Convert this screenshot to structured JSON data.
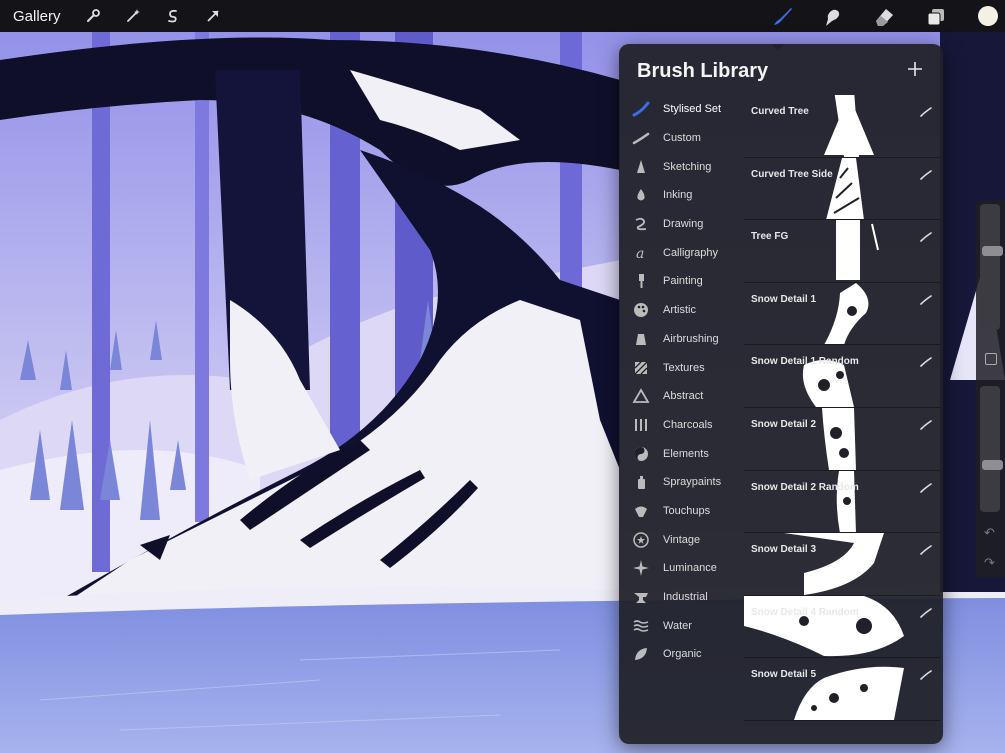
{
  "toolbar": {
    "gallery_label": "Gallery",
    "left_icons": [
      "wrench-icon",
      "magic-wand-icon",
      "selection-icon",
      "transform-arrow-icon"
    ],
    "right_icons": [
      "brush-icon",
      "smudge-icon",
      "eraser-icon",
      "layers-icon"
    ],
    "active_tool": "brush",
    "active_color": "#f4f1e4",
    "accent_color": "#3b6de8"
  },
  "brush_library": {
    "title": "Brush Library",
    "add_icon": "plus-icon",
    "sets": [
      {
        "label": "Stylised Set",
        "icon": "stylised-stroke-icon",
        "active": true
      },
      {
        "label": "Custom",
        "icon": "custom-stroke-icon"
      },
      {
        "label": "Sketching",
        "icon": "pencil-tip-icon"
      },
      {
        "label": "Inking",
        "icon": "ink-drop-icon"
      },
      {
        "label": "Drawing",
        "icon": "squiggle-icon"
      },
      {
        "label": "Calligraphy",
        "icon": "calligraphy-a-icon"
      },
      {
        "label": "Painting",
        "icon": "paintbrush-icon"
      },
      {
        "label": "Artistic",
        "icon": "palette-icon"
      },
      {
        "label": "Airbrushing",
        "icon": "airbrush-icon"
      },
      {
        "label": "Textures",
        "icon": "texture-icon"
      },
      {
        "label": "Abstract",
        "icon": "triangle-icon"
      },
      {
        "label": "Charcoals",
        "icon": "charcoal-sticks-icon"
      },
      {
        "label": "Elements",
        "icon": "yin-yang-icon"
      },
      {
        "label": "Spraypaints",
        "icon": "spray-can-icon"
      },
      {
        "label": "Touchups",
        "icon": "shell-icon"
      },
      {
        "label": "Vintage",
        "icon": "star-badge-icon"
      },
      {
        "label": "Luminance",
        "icon": "sparkle-icon"
      },
      {
        "label": "Industrial",
        "icon": "anvil-icon"
      },
      {
        "label": "Water",
        "icon": "waves-icon"
      },
      {
        "label": "Organic",
        "icon": "leaf-icon"
      }
    ],
    "brushes": [
      {
        "name": "Curved Tree"
      },
      {
        "name": "Curved Tree Side"
      },
      {
        "name": "Tree FG"
      },
      {
        "name": "Snow Detail 1"
      },
      {
        "name": "Snow Detail 1 Random"
      },
      {
        "name": "Snow Detail 2"
      },
      {
        "name": "Snow Detail 2 Random"
      },
      {
        "name": "Snow Detail 3"
      },
      {
        "name": "Snow Detail 4 Random"
      },
      {
        "name": "Snow Detail 5"
      }
    ]
  },
  "sidebar": {
    "size_slider_level": 0.64,
    "opacity_slider_level": 0.36
  }
}
